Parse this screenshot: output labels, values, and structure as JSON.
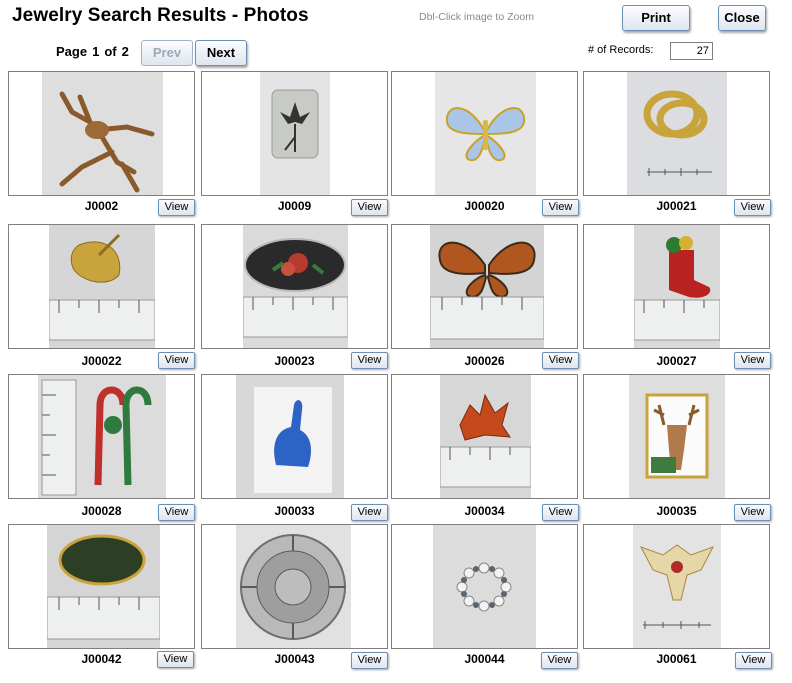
{
  "header": {
    "title": "Jewelry Search Results - Photos",
    "hint": "Dbl-Click image to Zoom",
    "print_label": "Print",
    "close_label": "Close"
  },
  "pager": {
    "page_word": "Page",
    "current_page": "1",
    "of_word": "of",
    "total_pages": "2",
    "prev_label": "Prev",
    "next_label": "Next"
  },
  "records": {
    "label": "# of Records:",
    "value": "27"
  },
  "items": [
    {
      "code": "J0002",
      "view_label": "View",
      "photo": "frog-brooch"
    },
    {
      "code": "J0009",
      "view_label": "View",
      "photo": "iris-pin"
    },
    {
      "code": "J00020",
      "view_label": "View",
      "photo": "butterfly-brooch"
    },
    {
      "code": "J00021",
      "view_label": "View",
      "photo": "gold-knot-brooch"
    },
    {
      "code": "J00022",
      "view_label": "View",
      "photo": "gold-leaf-pin"
    },
    {
      "code": "J00023",
      "view_label": "View",
      "photo": "painted-oval-brooch"
    },
    {
      "code": "J00026",
      "view_label": "View",
      "photo": "enamel-butterfly-pin"
    },
    {
      "code": "J00027",
      "view_label": "View",
      "photo": "christmas-stocking-pin"
    },
    {
      "code": "J00028",
      "view_label": "View",
      "photo": "candy-cane-pin"
    },
    {
      "code": "J00033",
      "view_label": "View",
      "photo": "blue-rabbit-pin"
    },
    {
      "code": "J00034",
      "view_label": "View",
      "photo": "autumn-leaf-pin"
    },
    {
      "code": "J00035",
      "view_label": "View",
      "photo": "deer-stamp-pin"
    },
    {
      "code": "J00042",
      "view_label": "View",
      "photo": "green-stone-brooch"
    },
    {
      "code": "J00043",
      "view_label": "View",
      "photo": "aztec-calendar-pin"
    },
    {
      "code": "J00044",
      "view_label": "View",
      "photo": "pearl-ring"
    },
    {
      "code": "J00061",
      "view_label": "View",
      "photo": "eagle-crest-pin"
    }
  ]
}
